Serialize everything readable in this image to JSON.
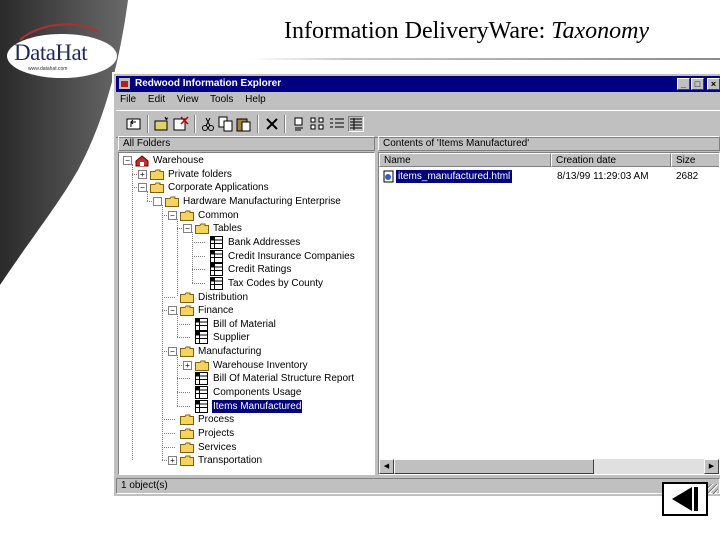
{
  "slide": {
    "logo_text": "DataHat",
    "logo_url": "www.datahat.com",
    "title_main": "Information DeliveryWare: ",
    "title_em": "Taxonomy"
  },
  "window": {
    "title": "Redwood Information Explorer",
    "menu": [
      "File",
      "Edit",
      "View",
      "Tools",
      "Help"
    ],
    "left_header": "All Folders",
    "right_header": "Contents of 'Items Manufactured'",
    "status": "1 object(s)"
  },
  "tree": [
    {
      "label": "Warehouse",
      "icon": "warehouse-icon",
      "expander": "minus"
    },
    {
      "label": "Private folders",
      "icon": "folder-icon",
      "expander": "plus"
    },
    {
      "label": "Corporate Applications",
      "icon": "folder-icon",
      "expander": "minus"
    },
    {
      "label": "Hardware Manufacturing Enterprise",
      "icon": "folder-icon",
      "expander": "box"
    },
    {
      "label": "Common",
      "icon": "folder-icon",
      "expander": "minus"
    },
    {
      "label": "Tables",
      "icon": "folder-icon",
      "expander": "minus"
    },
    {
      "label": "Bank Addresses",
      "icon": "table-icon",
      "expander": "none"
    },
    {
      "label": "Credit Insurance Companies",
      "icon": "table-icon",
      "expander": "none"
    },
    {
      "label": "Credit Ratings",
      "icon": "table-icon",
      "expander": "none"
    },
    {
      "label": "Tax Codes by County",
      "icon": "table-icon",
      "expander": "none"
    },
    {
      "label": "Distribution",
      "icon": "folder-icon",
      "expander": "none"
    },
    {
      "label": "Finance",
      "icon": "folder-icon",
      "expander": "minus"
    },
    {
      "label": "Bill of Material",
      "icon": "table-icon",
      "expander": "none"
    },
    {
      "label": "Supplier",
      "icon": "table-icon",
      "expander": "none"
    },
    {
      "label": "Manufacturing",
      "icon": "folder-icon",
      "expander": "minus"
    },
    {
      "label": "Warehouse Inventory",
      "icon": "folder-icon",
      "expander": "plus"
    },
    {
      "label": "Bill Of Material Structure Report",
      "icon": "table-icon",
      "expander": "none"
    },
    {
      "label": "Components Usage",
      "icon": "table-icon",
      "expander": "none"
    },
    {
      "label": "Items Manufactured",
      "icon": "table-icon",
      "expander": "none",
      "selected": true
    },
    {
      "label": "Process",
      "icon": "folder-icon",
      "expander": "none"
    },
    {
      "label": "Projects",
      "icon": "folder-icon",
      "expander": "none"
    },
    {
      "label": "Services",
      "icon": "folder-icon",
      "expander": "none"
    },
    {
      "label": "Transportation",
      "icon": "folder-icon",
      "expander": "plus"
    }
  ],
  "list": {
    "columns": [
      "Name",
      "Creation date",
      "Size"
    ],
    "rows": [
      {
        "name": "items_manufactured.html",
        "date": "8/13/99 11:29:03 AM",
        "size": "2682"
      }
    ]
  },
  "colors": {
    "titlebar": "#000080",
    "face": "#c0c0c0",
    "selection": "#000080"
  }
}
